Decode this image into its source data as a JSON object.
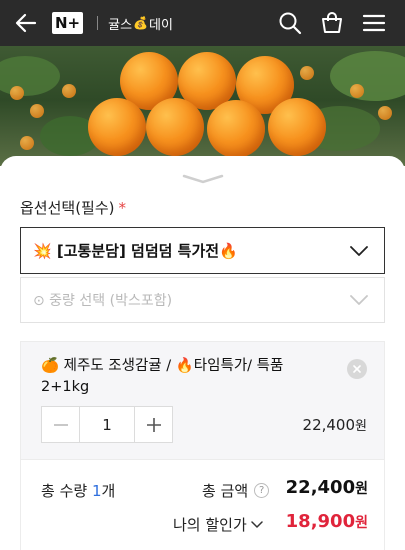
{
  "header": {
    "logo": "N+",
    "brand": "귤스",
    "brand_emoji": "💰",
    "brand_suffix": "데이",
    "icons": [
      "back-arrow-icon",
      "search-icon",
      "shopping-bag-icon",
      "hamburger-menu-icon"
    ]
  },
  "hero": {
    "alt_subject": "oranges-photo"
  },
  "options": {
    "title": "옵션선택(필수)",
    "required_mark": "*",
    "select1_value": "💥 [고통분담] 덤덤덤 특가전🔥",
    "select2_placeholder": "⊙ 중량 선택 (박스포함)"
  },
  "item": {
    "name": "🍊 제주도 조생감귤 / 🔥타임특가/ 특품 2+1kg",
    "quantity": "1",
    "price": "22,400",
    "price_unit": "원"
  },
  "summary": {
    "qty_label": "총 수량",
    "qty_value": "1",
    "qty_unit": "개",
    "total_label": "총 금액",
    "total_value": "22,400",
    "total_unit": "원",
    "discount_label": "나의 할인가",
    "discount_value": "18,900",
    "discount_unit": "원"
  },
  "colors": {
    "header_bg": "#2b2b2b",
    "required": "#e64545",
    "discount": "#e0243b",
    "qty_num": "#2f6fde"
  }
}
